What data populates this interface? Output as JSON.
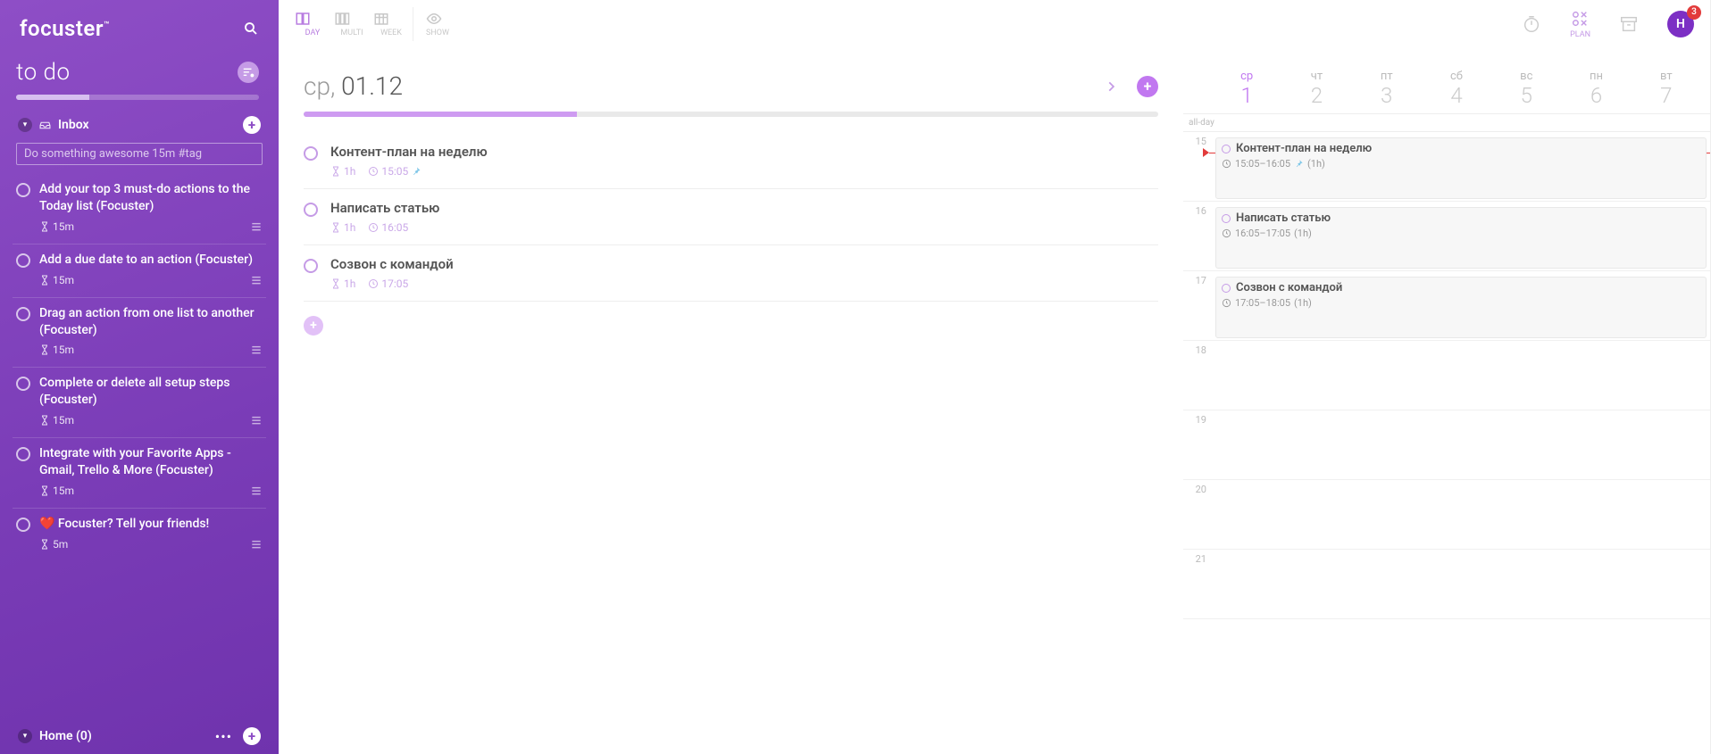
{
  "brand": "focuster",
  "sidebar": {
    "title": "to do",
    "progress_pct": 30,
    "inbox_label": "Inbox",
    "input_placeholder": "Do something awesome 15m #tag",
    "items": [
      {
        "title": "Add your top 3 must-do actions to the Today list (Focuster)",
        "duration": "15m"
      },
      {
        "title": "Add a due date to an action (Focuster)",
        "duration": "15m"
      },
      {
        "title": "Drag an action from one list to another (Focuster)",
        "duration": "15m"
      },
      {
        "title": "Complete or delete all setup steps (Focuster)",
        "duration": "15m"
      },
      {
        "title": "Integrate with your Favorite Apps - Gmail, Trello & More (Focuster)",
        "duration": "15m"
      },
      {
        "title": "❤️ Focuster? Tell your friends!",
        "duration": "5m"
      }
    ],
    "bottom_section": "Home (0)"
  },
  "topbar": {
    "views": {
      "day": "DAY",
      "multi": "MULTI",
      "week": "WEEK",
      "show": "SHOW"
    },
    "plan_label": "PLAN",
    "avatar_letter": "Н",
    "badge": "3"
  },
  "day": {
    "name": "ср,",
    "date": "01.12",
    "progress_pct": 32,
    "tasks": [
      {
        "title": "Контент-план на неделю",
        "duration": "1h",
        "time": "15:05",
        "pinned": true
      },
      {
        "title": "Написать статью",
        "duration": "1h",
        "time": "16:05",
        "pinned": false
      },
      {
        "title": "Созвон с командой",
        "duration": "1h",
        "time": "17:05",
        "pinned": false
      }
    ]
  },
  "calendar": {
    "all_day_label": "all-day",
    "days": [
      {
        "name": "ср",
        "num": "1",
        "active": true
      },
      {
        "name": "чт",
        "num": "2"
      },
      {
        "name": "пт",
        "num": "3"
      },
      {
        "name": "сб",
        "num": "4"
      },
      {
        "name": "вс",
        "num": "5"
      },
      {
        "name": "пн",
        "num": "6"
      },
      {
        "name": "вт",
        "num": "7"
      }
    ],
    "hours": [
      "15",
      "16",
      "17",
      "18",
      "19",
      "20",
      "21"
    ],
    "events": [
      {
        "hour_idx": 0,
        "title": "Контент-план на неделю",
        "meta": "15:05–16:05",
        "dur": "(1h)",
        "pinned": true
      },
      {
        "hour_idx": 1,
        "title": "Написать статью",
        "meta": "16:05–17:05",
        "dur": "(1h)",
        "pinned": false
      },
      {
        "hour_idx": 2,
        "title": "Созвон с командой",
        "meta": "17:05–18:05",
        "dur": "(1h)",
        "pinned": false
      }
    ]
  }
}
